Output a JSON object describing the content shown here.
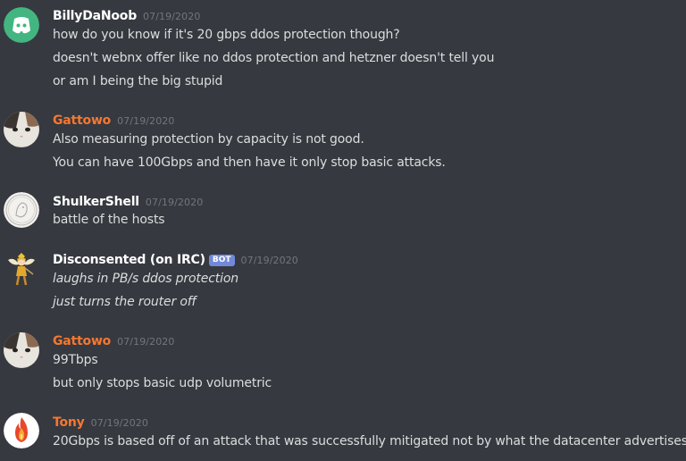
{
  "colors": {
    "background": "#36393f",
    "username_default": "#ffffff",
    "username_orange": "#f57731",
    "timestamp": "#72767d",
    "text": "#dcddde",
    "bot_badge": "#7289da",
    "discord_avatar": "#43b581"
  },
  "messages": [
    {
      "author": "BillyDaNoob",
      "timestamp": "07/19/2020",
      "avatar_icon": "discord-logo-icon",
      "lines": [
        "how do you know if it's 20 gbps ddos protection though?",
        "doesn't webnx offer like no ddos protection and hetzner doesn't tell you",
        "or am I being the big stupid"
      ]
    },
    {
      "author": "Gattowo",
      "timestamp": "07/19/2020",
      "avatar_icon": "cat-avatar-icon",
      "lines": [
        "Also measuring protection by capacity is not good.",
        "You can have 100Gbps and then have it only stop basic attacks."
      ]
    },
    {
      "author": "ShulkerShell",
      "timestamp": "07/19/2020",
      "avatar_icon": "coin-avatar-icon",
      "lines": [
        "battle of the hosts"
      ]
    },
    {
      "author": "Disconsented (on IRC)",
      "bot_badge": "BOT",
      "timestamp": "07/19/2020",
      "avatar_icon": "fairy-avatar-icon",
      "lines": [
        "laughs in PB/s ddos protection",
        "just turns the router off"
      ]
    },
    {
      "author": "Gattowo",
      "timestamp": "07/19/2020",
      "avatar_icon": "cat-avatar-icon",
      "lines": [
        "99Tbps",
        "but only stops basic udp volumetric"
      ]
    },
    {
      "author": "Tony",
      "timestamp": "07/19/2020",
      "avatar_icon": "fire-avatar-icon",
      "lines": [
        "20Gbps is based off of an attack that was successfully mitigated not by what the datacenter advertises."
      ]
    }
  ]
}
